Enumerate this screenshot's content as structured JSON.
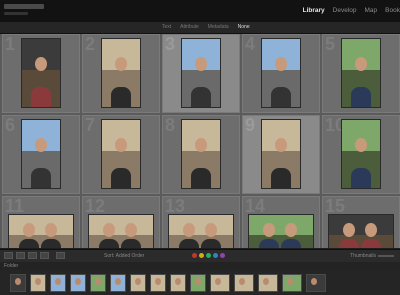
{
  "modules": [
    "Library",
    "Develop",
    "Map",
    "Book"
  ],
  "filter_tabs": [
    "Text",
    "Attribute",
    "Metadata",
    "None"
  ],
  "selected_filter": "None",
  "toolbar": {
    "sort_label": "Sort: Added Order",
    "thumbnails_label": "Thumbnails"
  },
  "filmstrip": {
    "title": "Folder"
  },
  "grid": [
    {
      "number": "1",
      "scene": "car",
      "orientation": "portrait"
    },
    {
      "number": "2",
      "scene": "indoor",
      "orientation": "portrait"
    },
    {
      "number": "3",
      "scene": "sky",
      "orientation": "portrait"
    },
    {
      "number": "4",
      "scene": "sky",
      "orientation": "portrait"
    },
    {
      "number": "5",
      "scene": "outdoor",
      "orientation": "portrait"
    },
    {
      "number": "6",
      "scene": "sky",
      "orientation": "portrait"
    },
    {
      "number": "7",
      "scene": "indoor",
      "orientation": "portrait"
    },
    {
      "number": "8",
      "scene": "indoor",
      "orientation": "portrait"
    },
    {
      "number": "9",
      "scene": "indoor",
      "orientation": "portrait"
    },
    {
      "number": "10",
      "scene": "outdoor",
      "orientation": "portrait"
    },
    {
      "number": "11",
      "scene": "indoor",
      "orientation": "landscape"
    },
    {
      "number": "12",
      "scene": "indoor",
      "orientation": "landscape"
    },
    {
      "number": "13",
      "scene": "indoor",
      "orientation": "landscape"
    },
    {
      "number": "14",
      "scene": "outdoor",
      "orientation": "landscape"
    },
    {
      "number": "15",
      "scene": "car",
      "orientation": "landscape"
    }
  ],
  "colors": {
    "grid_bg": "#5b5b5b",
    "cell_bg": "#6d6d6d",
    "panel": "#2b2b2b",
    "active_module": "#e6e6e6",
    "inactive_module": "#8a8a8a",
    "label_colors": [
      "#c0392b",
      "#d4ac0d",
      "#27ae60",
      "#2e86c1",
      "#8e44ad"
    ]
  }
}
